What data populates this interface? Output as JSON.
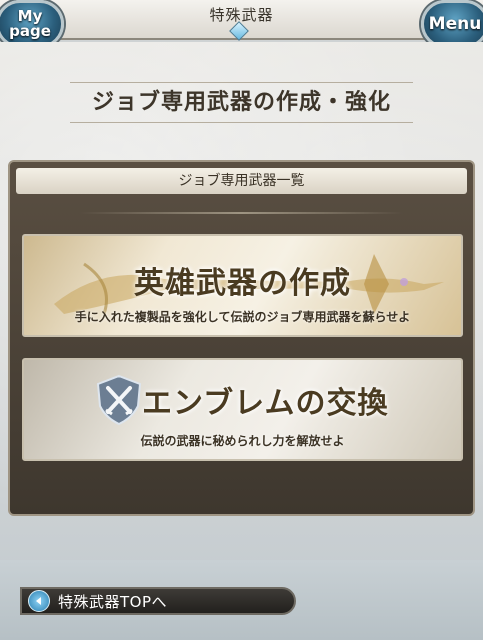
{
  "header": {
    "title": "特殊武器",
    "mypage_label": "My page",
    "menu_label": "Menu"
  },
  "page": {
    "heading": "ジョブ専用武器の作成・強化"
  },
  "panel": {
    "header": "ジョブ専用武器一覧",
    "cards": [
      {
        "title": "英雄武器の作成",
        "subtitle": "手に入れた複製品を強化して伝説のジョブ専用武器を蘇らせよ",
        "icon": "golden-sword-icon"
      },
      {
        "title": "エンブレムの交換",
        "subtitle": "伝説の武器に秘められし力を解放せよ",
        "icon": "crossed-swords-emblem-icon"
      }
    ]
  },
  "footer": {
    "back_label": "特殊武器TOPへ",
    "back_icon": "left-arrow-icon"
  }
}
